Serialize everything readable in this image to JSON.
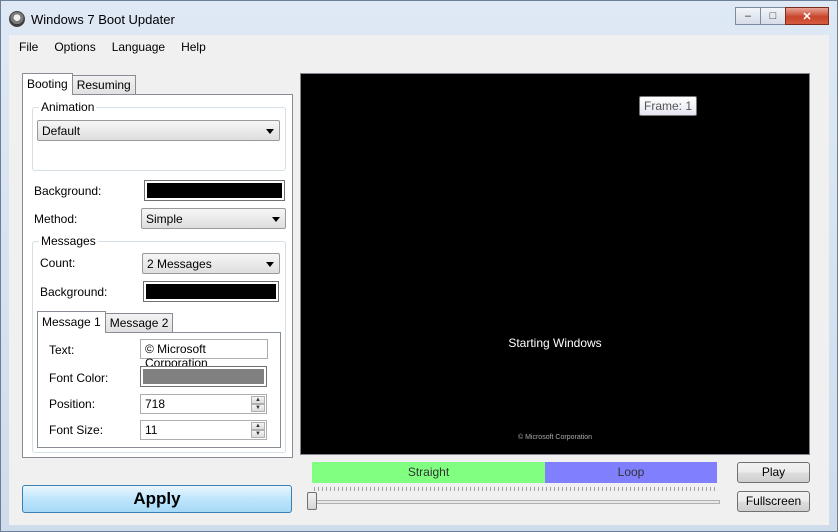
{
  "window": {
    "title": "Windows 7 Boot Updater",
    "minimize": "–",
    "maximize": "□",
    "close": "✕"
  },
  "menu": [
    "File",
    "Options",
    "Language",
    "Help"
  ],
  "tabs": {
    "booting": "Booting",
    "resuming": "Resuming"
  },
  "animation": {
    "legend": "Animation",
    "value": "Default"
  },
  "background": {
    "label": "Background:",
    "color": "#000000"
  },
  "method": {
    "label": "Method:",
    "value": "Simple"
  },
  "messages": {
    "legend": "Messages",
    "count_label": "Count:",
    "count_value": "2 Messages",
    "background_label": "Background:",
    "background_color": "#000000",
    "tabs": {
      "message1": "Message 1",
      "message2": "Message 2"
    },
    "text_label": "Text:",
    "text_value": "© Microsoft Corporation",
    "font_color_label": "Font Color:",
    "font_color": "#808080",
    "position_label": "Position:",
    "position_value": "718",
    "font_size_label": "Font Size:",
    "font_size_value": "11"
  },
  "apply_label": "Apply",
  "preview": {
    "frame_label": "Frame: 1",
    "starting_text": "Starting Windows",
    "copyright_text": "© Microsoft Corporation"
  },
  "timeline": {
    "straight": "Straight",
    "loop": "Loop",
    "straight_color": "#80ff80",
    "loop_color": "#8080ff"
  },
  "play_label": "Play",
  "fullscreen_label": "Fullscreen"
}
